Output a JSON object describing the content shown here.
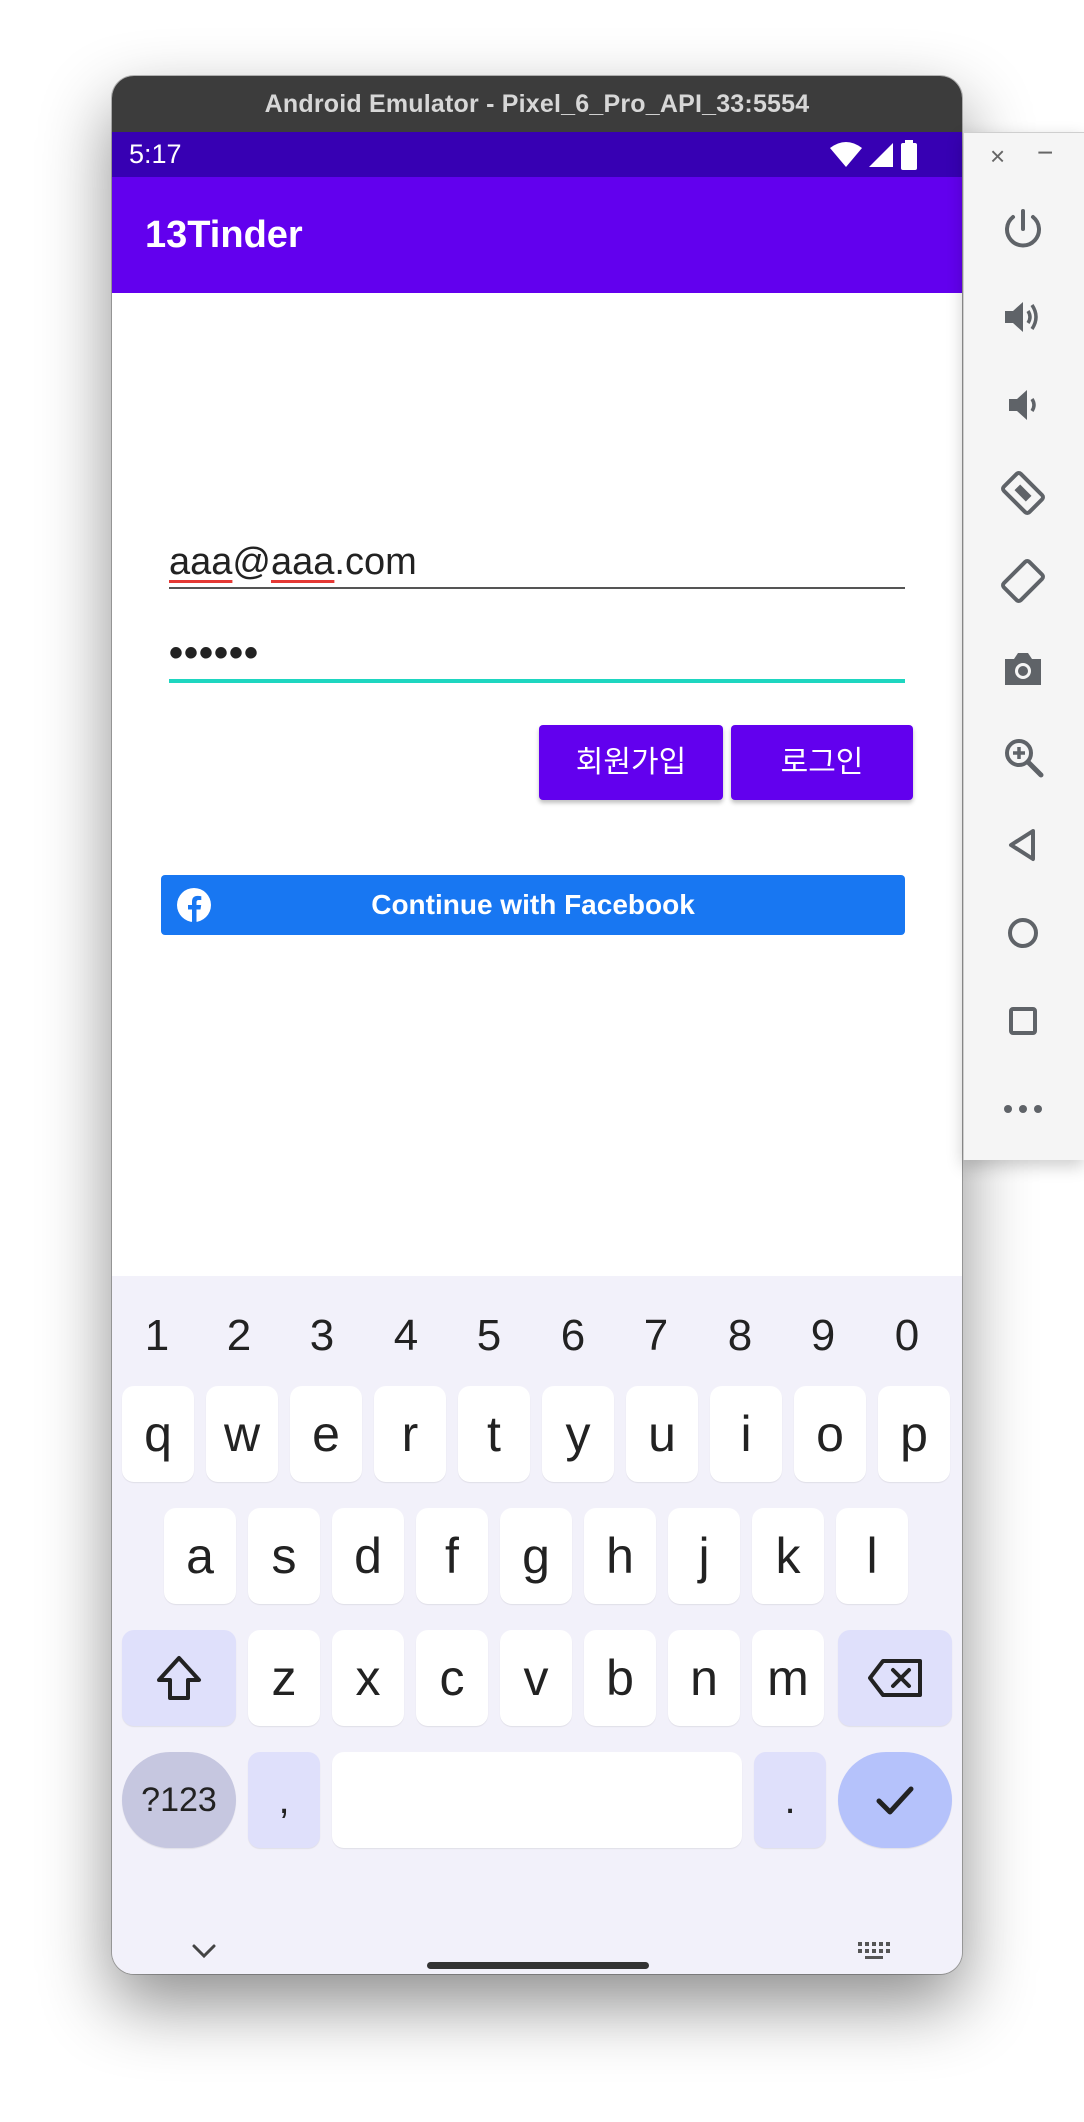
{
  "window": {
    "title": "Android Emulator - Pixel_6_Pro_API_33:5554"
  },
  "status_bar": {
    "time": "5:17",
    "icons": [
      "wifi-icon",
      "signal-icon",
      "battery-icon"
    ]
  },
  "app_bar": {
    "title": "13Tinder"
  },
  "login_form": {
    "email_value_parts": [
      "aaa",
      "@",
      "aaa",
      ".com"
    ],
    "password_value": "••••••",
    "signup_label": "회원가입",
    "login_label": "로그인"
  },
  "facebook_button": {
    "label": "Continue with Facebook",
    "icon": "facebook-icon"
  },
  "keyboard": {
    "number_row": [
      "1",
      "2",
      "3",
      "4",
      "5",
      "6",
      "7",
      "8",
      "9",
      "0"
    ],
    "row1": [
      "q",
      "w",
      "e",
      "r",
      "t",
      "y",
      "u",
      "i",
      "o",
      "p"
    ],
    "row2": [
      "a",
      "s",
      "d",
      "f",
      "g",
      "h",
      "j",
      "k",
      "l"
    ],
    "row3": [
      "z",
      "x",
      "c",
      "v",
      "b",
      "n",
      "m"
    ],
    "symbols_label": "?123",
    "comma_label": ",",
    "period_label": "."
  },
  "side_panel": {
    "icons": [
      "power-icon",
      "volume-up-icon",
      "volume-down-icon",
      "rotate-left-icon",
      "rotate-right-icon",
      "camera-icon",
      "zoom-icon",
      "back-icon",
      "home-icon",
      "overview-icon",
      "more-icon"
    ]
  },
  "colors": {
    "status_bar": "#3700b3",
    "app_bar": "#6200ee",
    "button": "#6200ee",
    "facebook": "#1877f2",
    "focus_underline": "#1ed6c0"
  }
}
